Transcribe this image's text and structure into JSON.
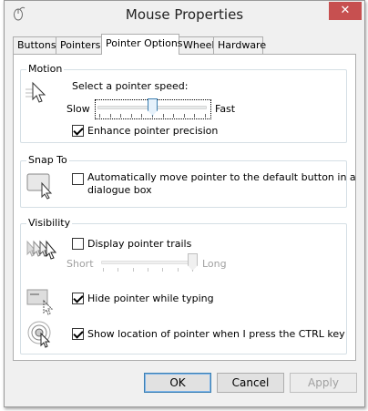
{
  "window": {
    "title": "Mouse Properties",
    "close_glyph": "✕"
  },
  "tabs": [
    {
      "label": "Buttons",
      "active": false
    },
    {
      "label": "Pointers",
      "active": false
    },
    {
      "label": "Pointer Options",
      "active": true
    },
    {
      "label": "Wheel",
      "active": false
    },
    {
      "label": "Hardware",
      "active": false
    }
  ],
  "motion": {
    "group_label": "Motion",
    "speed_prompt": "Select a pointer speed:",
    "slow_label": "Slow",
    "fast_label": "Fast",
    "speed_level": 0.5,
    "enhance_precision": {
      "label": "Enhance pointer precision",
      "checked": true
    }
  },
  "snap_to": {
    "group_label": "Snap To",
    "auto_move": {
      "label": "Automatically move pointer to the default button in a dialogue box",
      "line1": "Automatically move pointer to the default button in a",
      "line2": "dialogue box",
      "checked": false
    }
  },
  "visibility": {
    "group_label": "Visibility",
    "pointer_trails": {
      "label": "Display pointer trails",
      "checked": false
    },
    "short_label": "Short",
    "long_label": "Long",
    "trail_level": 1.0,
    "hide_while_typing": {
      "label": "Hide pointer while typing",
      "checked": true
    },
    "show_location": {
      "label": "Show location of pointer when I press the CTRL key",
      "checked": true
    }
  },
  "buttons": {
    "ok": "OK",
    "cancel": "Cancel",
    "apply": "Apply"
  },
  "colors": {
    "close_button": "#c75050",
    "group_border": "#d5dfe5",
    "focus_accent": "#3c7fb1"
  }
}
